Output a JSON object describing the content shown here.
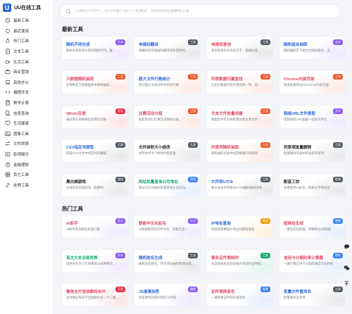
{
  "app": {
    "logo_letter": "U",
    "title": "UU在线工具"
  },
  "sidebar": {
    "items": [
      {
        "label": "最新工具",
        "icon": "clock-icon"
      },
      {
        "label": "最近使用",
        "icon": "history-icon"
      },
      {
        "label": "热门工具",
        "icon": "fire-icon"
      },
      {
        "label": "文本工具",
        "icon": "document-icon"
      },
      {
        "label": "生活工具",
        "icon": "coffee-icon"
      },
      {
        "label": "商业营销",
        "icon": "briefcase-icon"
      },
      {
        "label": "高效办公",
        "icon": "laptop-icon"
      },
      {
        "label": "编程开发",
        "icon": "code-icon"
      },
      {
        "label": "数学计算",
        "icon": "calculator-icon"
      },
      {
        "label": "信息查询",
        "icon": "search-doc-icon"
      },
      {
        "label": "生活健康",
        "icon": "heart-icon"
      },
      {
        "label": "图像工具",
        "icon": "image-icon"
      },
      {
        "label": "文件转换",
        "icon": "convert-icon"
      },
      {
        "label": "影视娱乐",
        "icon": "film-icon"
      },
      {
        "label": "金融理财",
        "icon": "coin-icon"
      },
      {
        "label": "其它工具",
        "icon": "grid-icon"
      },
      {
        "label": "友情工具",
        "icon": "link-icon"
      }
    ]
  },
  "search": {
    "placeholder": "工具共计742个，任何功能只需一个关键词，轻松找到您需要的工具"
  },
  "sections": {
    "latest": {
      "title": "最新工具",
      "tools": [
        {
          "title": "随机手持生成",
          "desc": "随机生成指定长度的随机手持。复...",
          "badge": "文本",
          "color": "#2f6bd8",
          "badge_color": "#8b5cf6"
        },
        {
          "title": "电报码翻译",
          "desc": "将编码后的电报码翻译还原回原始...",
          "badge": "工具",
          "color": "#2f6bd8",
          "badge_color": "#555b66"
        },
        {
          "title": "电报码查询",
          "desc": "查询电报码对应的汉字，电报码查...",
          "badge": "工具",
          "color": "#e0486b",
          "badge_color": "#555b66"
        },
        {
          "title": "随机组合抽取",
          "desc": "随机抽取若干组合为随机组合，支...",
          "badge": "文本",
          "color": "#2f6bd8",
          "badge_color": "#8b5cf6"
        },
        {
          "title": "大数据随机抽奖",
          "desc": "在特数百万级数据库中随机抽取...",
          "badge": "工具",
          "color": "#e0486b",
          "badge_color": "#ef5a2f"
        },
        {
          "title": "超大文件行数统计",
          "desc": "统计超大文本文件中的总行数",
          "badge": "工具",
          "color": "#2f6bd8",
          "badge_color": "#ef5a2f"
        },
        {
          "title": "列表数据归属查找",
          "desc": "在超大数据列表中查找每一项，对...",
          "badge": "工具",
          "color": "#e0486b",
          "badge_color": "#ef5a2f"
        },
        {
          "title": "Chrome内部页面",
          "desc": "快速查看和访问Chrome内部页面",
          "badge": "工具",
          "color": "#e0486b",
          "badge_color": "#ef5a2f"
        },
        {
          "title": "Whois反查",
          "desc": "通过姓名和邮箱反查域名列表",
          "badge": "开发",
          "color": "#e0486b",
          "badge_color": "#e8334a"
        },
        {
          "title": "比赛活动分组",
          "desc": "轻松地进行比赛活动随机分组",
          "badge": "工具",
          "color": "#e0486b",
          "badge_color": "#ef5a2f"
        },
        {
          "title": "文本文件批量创建",
          "desc": "根据文件名列表批量创建文本文件",
          "badge": "工具",
          "color": "#e0486b",
          "badge_color": "#ef5a2f"
        },
        {
          "title": "链接URL文件提取",
          "desc": "提取链接URL截图一起的文件名",
          "badge": "文本",
          "color": "#2f6bd8",
          "badge_color": "#8b5cf6"
        },
        {
          "title": "CSV指定列提取",
          "desc": "提取CSV文件中指定列的数据",
          "badge": "工具",
          "color": "#2f6bd8",
          "badge_color": "#555b66"
        },
        {
          "title": "文件体积大小修改",
          "desc": "修改文件大小修改为指定值",
          "badge": "工具",
          "color": "#222222",
          "badge_color": "#555b66"
        },
        {
          "title": "列表项随机抽取",
          "desc": "随机抽取列表中指定数量的列表项",
          "badge": "工具",
          "color": "#e0486b",
          "badge_color": "#ef5a2f"
        },
        {
          "title": "列表项批量删除",
          "desc": "批量删除列表中的指定列表项",
          "badge": "工具",
          "color": "#222222",
          "badge_color": "#555b66"
        },
        {
          "title": "黑白棋游戏",
          "desc": "在线玩黑白棋游戏（奥赛罗）",
          "badge": "游戏",
          "color": "#222222",
          "badge_color": "#555b66"
        },
        {
          "title": "网站批量查询公司地址",
          "desc": "通过企业的域名批量查询企业的详...",
          "badge": "营销",
          "color": "#19a974",
          "badge_color": "#3b82f6"
        },
        {
          "title": "文件转UTF8",
          "desc": "将文本文件转换为UTF8编码格式文件",
          "badge": "工具",
          "color": "#2f6bd8",
          "badge_color": "#555b66"
        },
        {
          "title": "配音工坊",
          "desc": "免费使用AI配音，轻松文字转语音",
          "badge": "视频",
          "color": "#222222",
          "badge_color": "#555b66"
        }
      ]
    },
    "hot": {
      "title": "热门工具",
      "tools": [
        {
          "title": "AI助手",
          "desc": "AI助手帮你回答各类问题",
          "badge": "其它",
          "color": "#e0486b",
          "badge_color": "#8b5cf6"
        },
        {
          "title": "智能中文名起名",
          "desc": "AI智能推荐好的中文名，轻松为宝...",
          "badge": "生活",
          "color": "#e0486b",
          "badge_color": "#8b5cf6"
        },
        {
          "title": "IP地址查询",
          "desc": "快速查看精度IP地址归属地查询",
          "badge": "查询",
          "color": "#2f6bd8",
          "badge_color": "#f59e0b"
        },
        {
          "title": "短网址生成",
          "desc": "一键生成短链接，转换网址/短链接",
          "badge": "营销",
          "color": "#e0486b",
          "badge_color": "#3b82f6"
        },
        {
          "title": "英文文本全能转换",
          "desc": "提供英文大小写转换等10多种英文...",
          "badge": "文本",
          "color": "#19a974",
          "badge_color": "#8b5cf6"
        },
        {
          "title": "随机姓名生成",
          "desc": "随机生成姓名。用于活动抽奖和测试使...",
          "badge": "工具",
          "color": "#2f6bd8",
          "badge_color": "#555b66"
        },
        {
          "title": "报名证件照制作",
          "desc": "为您快速生成合适报名考试的证件照...",
          "badge": "工具",
          "color": "#e0486b",
          "badge_color": "#19a974"
        },
        {
          "title": "信用卡分期利率计算器",
          "desc": "一键计算信用卡分期的真实年化利率",
          "badge": "理财",
          "color": "#e0486b",
          "badge_color": "#3b82f6"
        },
        {
          "title": "微信支付宝收款码合并",
          "desc": "合并微信和支付宝收款码为一个二维...",
          "badge": "开发",
          "color": "#e0486b",
          "badge_color": "#e8334a"
        },
        {
          "title": "JS混淆加密",
          "desc": "加密源代码保护您的JS代码",
          "badge": "编程",
          "color": "#2f6bd8",
          "badge_color": "#8b5cf6"
        },
        {
          "title": "证件照换底色",
          "desc": "一键更换证件照背景底色",
          "badge": "图像",
          "color": "#e0486b",
          "badge_color": "#3b82f6"
        },
        {
          "title": "批量文件重命名",
          "desc": "批量重命名文件",
          "badge": "工具",
          "color": "#2f6bd8",
          "badge_color": "#555b66"
        }
      ]
    }
  },
  "floating": [
    {
      "icon": "chat-icon"
    },
    {
      "icon": "wechat-icon"
    },
    {
      "icon": "back-to-top-icon"
    }
  ]
}
